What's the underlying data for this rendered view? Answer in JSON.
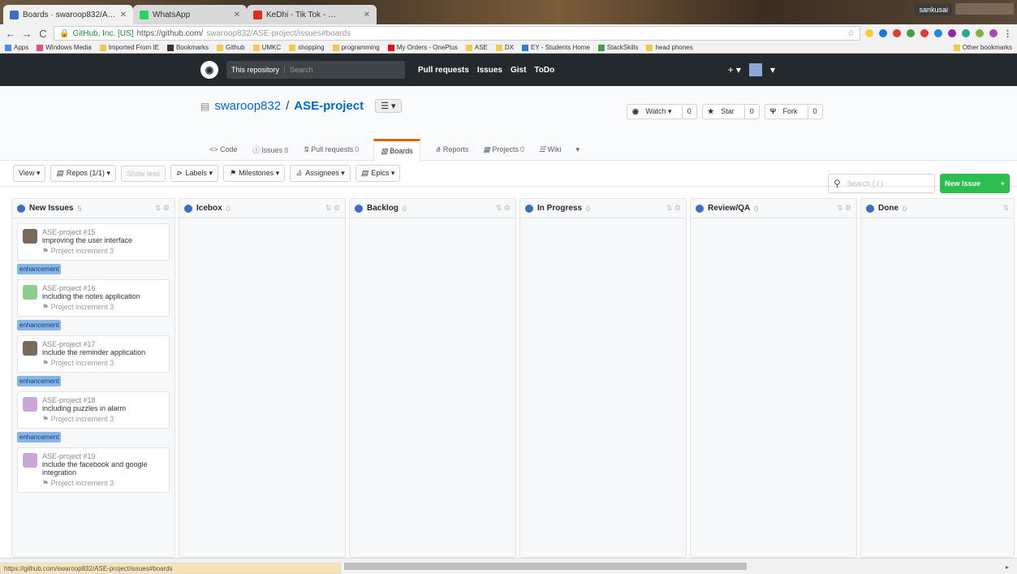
{
  "browser": {
    "tabs": [
      {
        "label": "Boards · swaroop832/A…",
        "fav_color": "#3b6ec4"
      },
      {
        "label": "WhatsApp",
        "fav_color": "#25d366"
      },
      {
        "label": "KeDhi - Tik Tok - …",
        "fav_color": "#d93025"
      }
    ],
    "user": "sankusai",
    "secure_label": "GitHub, Inc. [US]",
    "url_host": "https://github.com/",
    "url_path": "swaroop832/ASE-project/issues#boards",
    "bookmarks": [
      "Apps",
      "Windows Media",
      "Imported From IE",
      "Bookmarks",
      "Github",
      "UMKC",
      "shopping",
      "programming",
      "My Orders - OnePlus",
      "ASE",
      "DX",
      "EY - Students Home",
      "StackSkills",
      "head phones"
    ],
    "other_bookmarks": "Other bookmarks",
    "status_url": "https://github.com/swaroop832/ASE-project/issues#boards"
  },
  "github": {
    "search_scope": "This repository",
    "search_placeholder": "Search",
    "nav": [
      "Pull requests",
      "Issues",
      "Gist",
      "ToDo"
    ],
    "plus": "+ ▾"
  },
  "repo": {
    "owner": "swaroop832",
    "separator": "/",
    "name": "ASE-project",
    "watch_label": "Watch ▾",
    "watch_count": "0",
    "star_label": "Star",
    "star_count": "0",
    "fork_label": "Fork",
    "fork_count": "0",
    "tabs": [
      {
        "label": "Code",
        "count": ""
      },
      {
        "label": "Issues",
        "count": "8"
      },
      {
        "label": "Pull requests",
        "count": "0"
      },
      {
        "label": "Boards",
        "count": ""
      },
      {
        "label": "Reports",
        "count": ""
      },
      {
        "label": "Projects",
        "count": "0"
      },
      {
        "label": "Wiki",
        "count": ""
      }
    ]
  },
  "toolbar": {
    "view": "View ▾",
    "repos": "Repos (1/1) ▾",
    "show_less": "Show less",
    "labels": "Labels ▾",
    "milestones": "Milestones ▾",
    "assignees": "Assignees ▾",
    "epics": "Epics ▾",
    "search_placeholder": "Search ( / )",
    "new_issue": "New Issue",
    "new_issue_plus": "+"
  },
  "columns": [
    {
      "name": "New Issues",
      "count": "5"
    },
    {
      "name": "Icebox",
      "count": "0"
    },
    {
      "name": "Backlog",
      "count": "0"
    },
    {
      "name": "In Progress",
      "count": "0"
    },
    {
      "name": "Review/QA",
      "count": "0"
    },
    {
      "name": "Done",
      "count": "0"
    }
  ],
  "cards": [
    {
      "ref": "ASE-project #15",
      "title": "improving the user interface",
      "milestone": "Project increment 3",
      "label": "enhancement",
      "avatar_color": "#7a6a5a"
    },
    {
      "ref": "ASE-project #16",
      "title": "including the notes application",
      "milestone": "Project increment 3",
      "label": "enhancement",
      "avatar_color": "#8ccf8c"
    },
    {
      "ref": "ASE-project #17",
      "title": "include the reminder application",
      "milestone": "Project increment 3",
      "label": "enhancement",
      "avatar_color": "#7a6a5a"
    },
    {
      "ref": "ASE-project #18",
      "title": "including puzzles in alarm",
      "milestone": "Project increment 3",
      "label": "enhancement",
      "avatar_color": "#c9a8d8"
    },
    {
      "ref": "ASE-project #19",
      "title": "include the facebook and google integration",
      "milestone": "Project increment 3",
      "label": "",
      "avatar_color": "#c9a8d8"
    }
  ]
}
